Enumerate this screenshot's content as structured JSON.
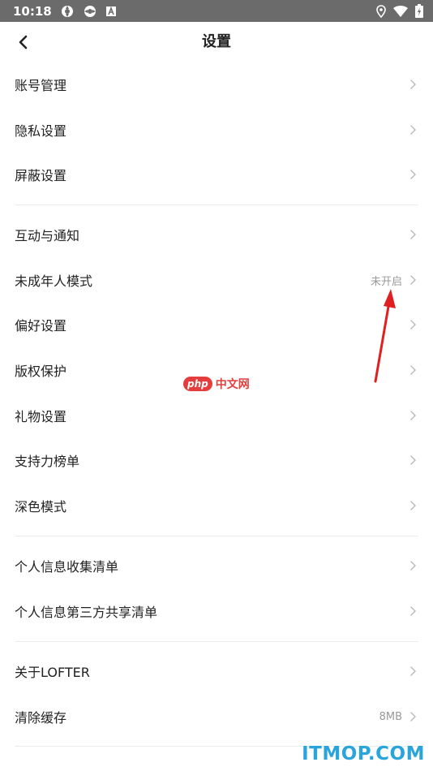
{
  "status_bar": {
    "time": "10:18",
    "left_icons": [
      "sync-icon",
      "sync-icon",
      "font-icon"
    ],
    "right_icons": [
      "location-icon",
      "wifi-icon",
      "battery-icon"
    ]
  },
  "nav": {
    "back_icon": "chevron-left-icon",
    "title": "设置"
  },
  "settings": [
    {
      "label": "账号管理",
      "value": ""
    },
    {
      "label": "隐私设置",
      "value": ""
    },
    {
      "label": "屏蔽设置",
      "value": ""
    },
    {
      "label": "互动与通知",
      "value": ""
    },
    {
      "label": "未成年人模式",
      "value": "未开启"
    },
    {
      "label": "偏好设置",
      "value": ""
    },
    {
      "label": "版权保护",
      "value": ""
    },
    {
      "label": "礼物设置",
      "value": ""
    },
    {
      "label": "支持力榜单",
      "value": ""
    },
    {
      "label": "深色模式",
      "value": ""
    },
    {
      "label": "个人信息收集清单",
      "value": ""
    },
    {
      "label": "个人信息第三方共享清单",
      "value": ""
    },
    {
      "label": "关于LOFTER",
      "value": ""
    },
    {
      "label": "清除缓存",
      "value": "8MB"
    }
  ],
  "watermarks": {
    "php_badge": "php",
    "php_text": "中文网",
    "itmop": "ITMOP.COM"
  },
  "colors": {
    "status_bar": "#6b6b6b",
    "annotation_arrow": "#e02020",
    "itmop_blue": "#2aa4dd"
  }
}
